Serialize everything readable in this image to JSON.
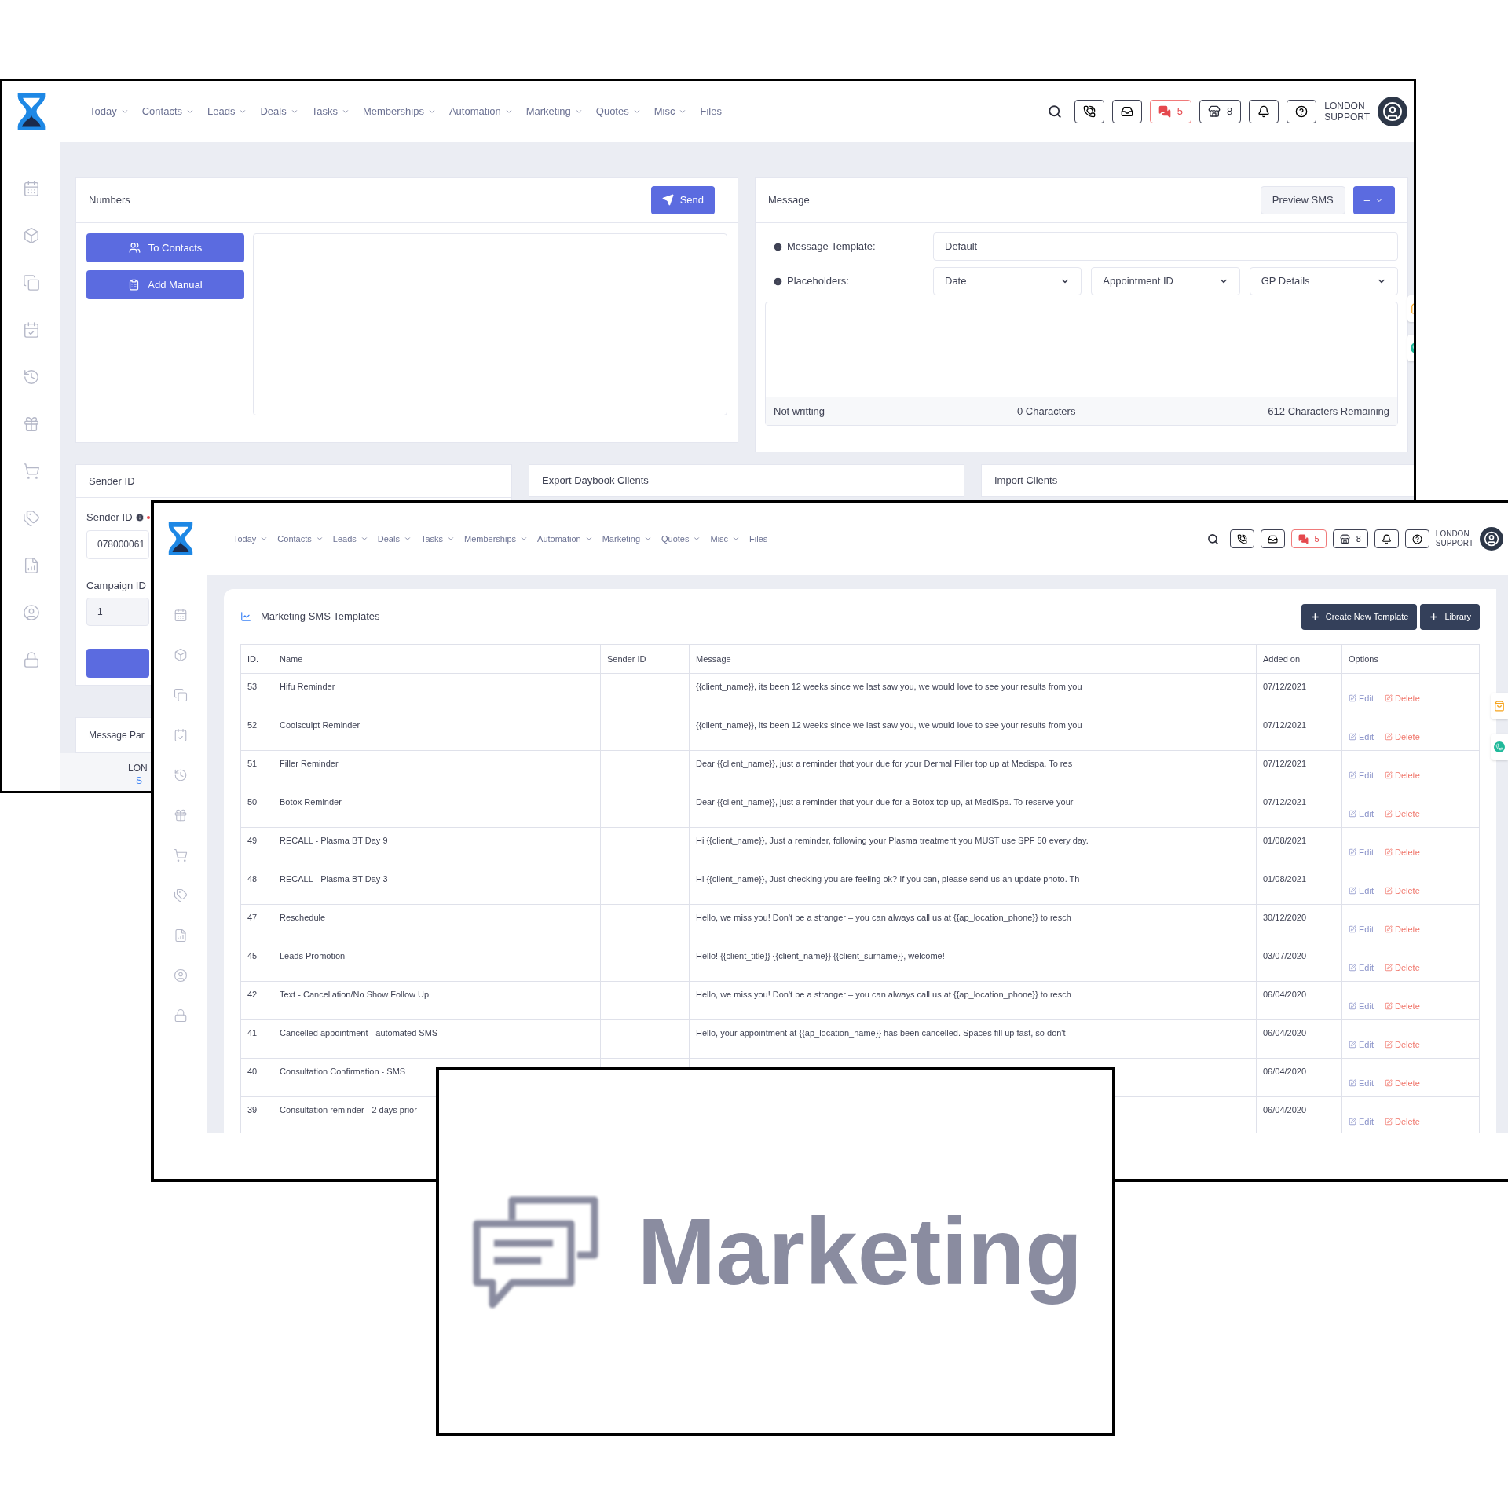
{
  "sms_window": {
    "header": {
      "nav": [
        {
          "label": "Today",
          "dropdown": true
        },
        {
          "label": "Contacts",
          "dropdown": true
        },
        {
          "label": "Leads",
          "dropdown": true
        },
        {
          "label": "Deals",
          "dropdown": true
        },
        {
          "label": "Tasks",
          "dropdown": true
        },
        {
          "label": "Memberships",
          "dropdown": true
        },
        {
          "label": "Automation",
          "dropdown": true
        },
        {
          "label": "Marketing",
          "dropdown": true
        },
        {
          "label": "Quotes",
          "dropdown": true
        },
        {
          "label": "Misc",
          "dropdown": true
        },
        {
          "label": "Files",
          "dropdown": false
        }
      ],
      "chat_count": "5",
      "store_count": "8",
      "user": [
        "LONDON",
        "SUPPORT"
      ]
    },
    "numbers_panel": {
      "title": "Numbers",
      "send_button": "Send",
      "buttons": [
        "To Contacts",
        "Add Manual"
      ]
    },
    "message_panel": {
      "title": "Message",
      "preview_button": "Preview SMS",
      "menu_button": "–",
      "template_label": "Message Template:",
      "template_value": "Default",
      "placeholders_label": "Placeholders:",
      "placeholder_selects": [
        "Date",
        "Appointment ID",
        "GP Details"
      ],
      "status": "Not writting",
      "char_count": "0 Characters",
      "remaining": "612 Characters Remaining"
    },
    "sender_panel": {
      "title": "Sender ID",
      "sender_label": "Sender ID",
      "required": true,
      "sender_value": "078000061",
      "campaign_label": "Campaign ID",
      "campaign_value": "1"
    },
    "export_panel": {
      "title": "Export Daybook Clients"
    },
    "import_panel": {
      "title": "Import Clients"
    },
    "params_panel": {
      "title": "Message Par"
    },
    "footer": [
      "LON",
      "S"
    ]
  },
  "templates_window": {
    "header": {
      "nav": [
        {
          "label": "Today",
          "dropdown": true
        },
        {
          "label": "Contacts",
          "dropdown": true
        },
        {
          "label": "Leads",
          "dropdown": true
        },
        {
          "label": "Deals",
          "dropdown": true
        },
        {
          "label": "Tasks",
          "dropdown": true
        },
        {
          "label": "Memberships",
          "dropdown": true
        },
        {
          "label": "Automation",
          "dropdown": true
        },
        {
          "label": "Marketing",
          "dropdown": true
        },
        {
          "label": "Quotes",
          "dropdown": true
        },
        {
          "label": "Misc",
          "dropdown": true
        },
        {
          "label": "Files",
          "dropdown": false
        }
      ],
      "chat_count": "5",
      "store_count": "8",
      "user": [
        "LONDON",
        "SUPPORT"
      ]
    },
    "title": "Marketing SMS Templates",
    "buttons": [
      "Create New Template",
      "Library"
    ],
    "table": {
      "columns": [
        "ID.",
        "Name",
        "Sender ID",
        "Message",
        "Added on",
        "Options"
      ],
      "rows": [
        {
          "id": "53",
          "name": "Hifu Reminder",
          "message": "{{client_name}}, its been 12 weeks since we last saw you, we would love to see your results from you",
          "added_on": "07/12/2021",
          "actions": [
            "Edit",
            "Delete"
          ]
        },
        {
          "id": "52",
          "name": "Coolsculpt Reminder",
          "message": "{{client_name}}, its been 12 weeks since we last saw you, we would love to see your results from you",
          "added_on": "07/12/2021",
          "actions": [
            "Edit",
            "Delete"
          ]
        },
        {
          "id": "51",
          "name": "Filler Reminder",
          "message": "Dear {{client_name}}, just a reminder that your due for your Dermal Filler top up at Medispa. To res",
          "added_on": "07/12/2021",
          "actions": [
            "Edit",
            "Delete"
          ]
        },
        {
          "id": "50",
          "name": "Botox Reminder",
          "message": "Dear {{client_name}}, just a reminder that your due for a Botox top up, at MediSpa. To reserve your",
          "added_on": "07/12/2021",
          "actions": [
            "Edit",
            "Delete"
          ]
        },
        {
          "id": "49",
          "name": "RECALL - Plasma BT Day 9",
          "message": "Hi {{client_name}}, Just a reminder, following your Plasma treatment you MUST use SPF 50 every day.",
          "added_on": "01/08/2021",
          "actions": [
            "Edit",
            "Delete"
          ]
        },
        {
          "id": "48",
          "name": "RECALL - Plasma BT Day 3",
          "message": "Hi {{client_name}}, Just checking you are feeling ok? If you can, please send us an update photo. Th",
          "added_on": "01/08/2021",
          "actions": [
            "Edit",
            "Delete"
          ]
        },
        {
          "id": "47",
          "name": "Reschedule",
          "message": "Hello, we miss you! Don't be a stranger – you can always call us at {{ap_location_phone}} to resch",
          "added_on": "30/12/2020",
          "actions": [
            "Edit",
            "Delete"
          ]
        },
        {
          "id": "45",
          "name": "Leads Promotion",
          "message": "Hello! {{client_title}} {{client_name}} {{client_surname}}, welcome!",
          "added_on": "03/07/2020",
          "actions": [
            "Edit",
            "Delete"
          ]
        },
        {
          "id": "42",
          "name": "Text - Cancellation/No Show Follow Up",
          "message": "Hello, we miss you! Don't be a stranger – you can always call us at {{ap_location_phone}} to resch",
          "added_on": "06/04/2020",
          "actions": [
            "Edit",
            "Delete"
          ]
        },
        {
          "id": "41",
          "name": "Cancelled appointment - automated SMS",
          "message": "Hello, your appointment at {{ap_location_name}} has been cancelled. Spaces fill up fast, so don't",
          "added_on": "06/04/2020",
          "actions": [
            "Edit",
            "Delete"
          ]
        },
        {
          "id": "40",
          "name": "Consultation Confirmation - SMS",
          "added_on": "06/04/2020",
          "actions": [
            "Edit",
            "Delete"
          ]
        },
        {
          "id": "39",
          "name": "Consultation reminder - 2 days prior",
          "added_on": "06/04/2020",
          "actions": [
            "Edit",
            "Delete"
          ]
        }
      ]
    }
  },
  "marketing_window": {
    "title": "Marketing"
  }
}
